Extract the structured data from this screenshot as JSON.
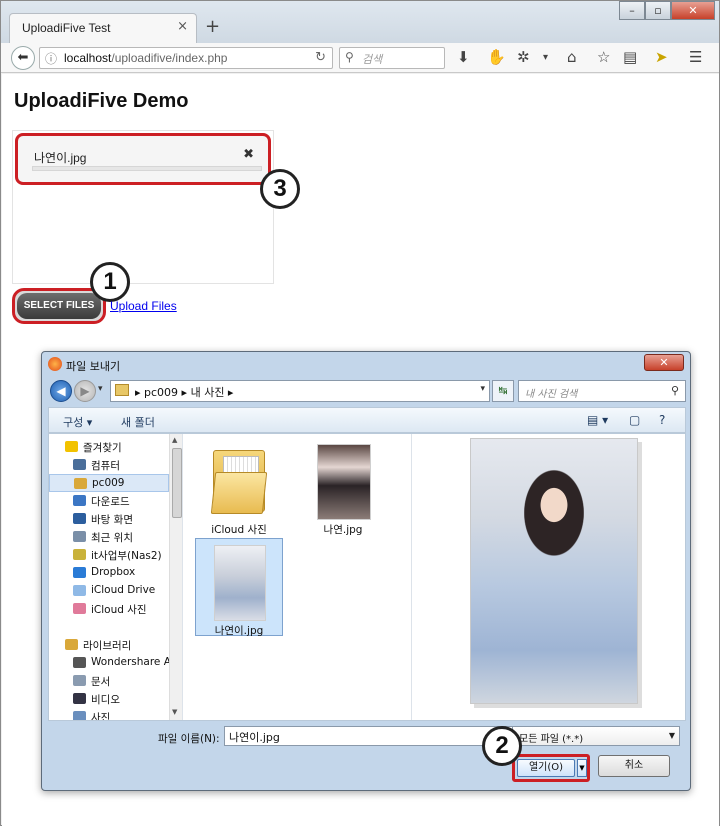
{
  "browser": {
    "tab_title": "UploadiFive Test",
    "tab_close": "×",
    "new_tab": "+",
    "window_buttons": {
      "minimize": "–",
      "maximize": "▫",
      "close": "✕"
    },
    "url_host": "localhost",
    "url_path": "/uploadifive/index.php",
    "search_placeholder": "검색"
  },
  "page": {
    "title": "UploadiFive Demo",
    "queue_item": {
      "filename": "나연이.jpg",
      "close": "✖",
      "progress": 0
    },
    "select_files_label": "SELECT FILES",
    "upload_files_label": "Upload Files"
  },
  "badges": {
    "one": "1",
    "two": "2",
    "three": "3"
  },
  "dialog": {
    "title": "파일 보내기",
    "close": "✕",
    "breadcrumb": [
      "pc009",
      "내 사진"
    ],
    "search_placeholder": "내 사진 검색",
    "commands": {
      "organize": "구성 ▾",
      "new_folder": "새 폴더"
    },
    "nav_items": [
      {
        "label": "즐겨찾기",
        "icon": "star-icon"
      },
      {
        "label": "컴퓨터",
        "icon": "computer-icon"
      },
      {
        "label": "pc009",
        "icon": "user-folder-icon"
      },
      {
        "label": "다운로드",
        "icon": "downloads-icon"
      },
      {
        "label": "바탕 화면",
        "icon": "desktop-icon"
      },
      {
        "label": "최근 위치",
        "icon": "recent-icon"
      },
      {
        "label": "it사업부(Nas2)",
        "icon": "network-icon"
      },
      {
        "label": "Dropbox",
        "icon": "dropbox-icon"
      },
      {
        "label": "iCloud Drive",
        "icon": "cloud-icon"
      },
      {
        "label": "iCloud 사진",
        "icon": "photos-icon"
      },
      {
        "label": "라이브러리",
        "icon": "library-icon"
      },
      {
        "label": "Wondershare All",
        "icon": "app-icon"
      },
      {
        "label": "문서",
        "icon": "documents-icon"
      },
      {
        "label": "비디오",
        "icon": "video-icon"
      },
      {
        "label": "사진",
        "icon": "pictures-icon"
      }
    ],
    "files": [
      {
        "name": "iCloud 사진"
      },
      {
        "name": "나연.jpg"
      },
      {
        "name": "나연이.jpg"
      }
    ],
    "filename_label": "파일 이름(N):",
    "filename_value": "나연이.jpg",
    "filetype_value": "모든 파일 (*.*)",
    "open_label": "열기(O)",
    "cancel_label": "취소"
  }
}
